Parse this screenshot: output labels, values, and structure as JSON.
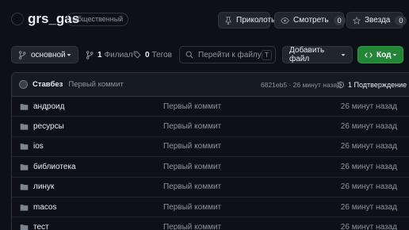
{
  "repo": {
    "name": "grs_gas",
    "visibility": "Общественный"
  },
  "header_actions": {
    "pin_label": "Приколоть",
    "watch_label": "Смотреть",
    "watch_count": "0",
    "star_label": "Звезда",
    "star_count": "0"
  },
  "toolbar": {
    "branch_name": "основной",
    "branches_count": "1",
    "branches_label": "Филиал",
    "tags_count": "0",
    "tags_label": "Тегов",
    "search_placeholder": "Перейти к файлу",
    "search_shortcut": "T",
    "add_file_label": "Добавить файл",
    "code_label": "Код"
  },
  "latest_commit": {
    "author": "Ставбез",
    "message": "Первый коммит",
    "hash_time": "6821eb5 · 26 минут назад",
    "history_label": "1 Подтверждение"
  },
  "files": [
    {
      "name": "андроид",
      "commit": "Первый коммит",
      "time": "26 минут назад"
    },
    {
      "name": "ресурсы",
      "commit": "Первый коммит",
      "time": "26 минут назад"
    },
    {
      "name": "ios",
      "commit": "Первый коммит",
      "time": "26 минут назад"
    },
    {
      "name": "библиотека",
      "commit": "Первый коммит",
      "time": "26 минут назад"
    },
    {
      "name": "линук",
      "commit": "Первый коммит",
      "time": "26 минут назад"
    },
    {
      "name": "macos",
      "commit": "Первый коммит",
      "time": "26 минут назад"
    },
    {
      "name": "тест",
      "commit": "Первый коммит",
      "time": "26 минут назад"
    }
  ],
  "colors": {
    "background": "#0d1117",
    "border": "#30363d",
    "button_bg": "#21262d",
    "code_button": "#238636",
    "muted_text": "#8b949e",
    "folder_icon": "#7d8590"
  }
}
